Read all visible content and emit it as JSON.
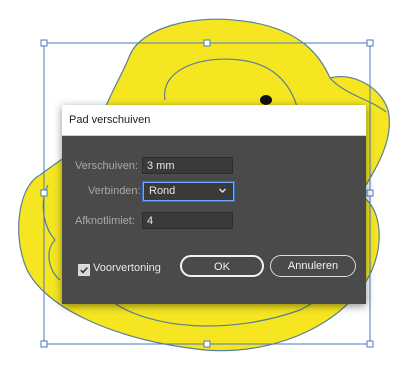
{
  "dialog": {
    "title": "Pad verschuiven",
    "offset_label": "Verschuiven:",
    "offset_value": "3 mm",
    "join_label": "Verbinden:",
    "join_value": "Rond",
    "miter_label": "Afknotlimiet:",
    "miter_value": "4",
    "preview_label": "Voorvertoning",
    "preview_checked": true,
    "ok_label": "OK",
    "cancel_label": "Annuleren"
  },
  "colors": {
    "duck_fill": "#f5e621",
    "duck_stroke": "#5b7f96",
    "selection": "#4a78c4",
    "dialog_bg": "#4a4a4a",
    "focus_ring": "#6fa8ff"
  },
  "icons": {
    "dropdown": "chevron-down-icon",
    "checkbox": "checkmark-icon"
  }
}
